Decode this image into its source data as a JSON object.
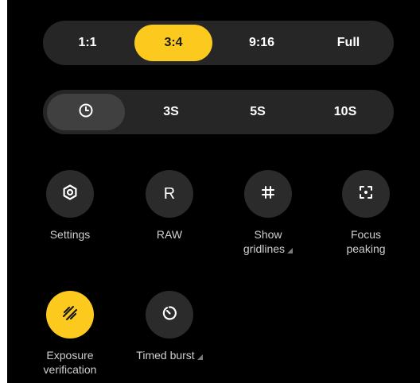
{
  "aspect_ratio": {
    "options": [
      "1:1",
      "3:4",
      "9:16",
      "Full"
    ],
    "selected": "3:4"
  },
  "timer": {
    "options": [
      "clock-icon",
      "3S",
      "5S",
      "10S"
    ],
    "selected": "clock-icon"
  },
  "tiles": [
    {
      "icon": "gear-icon",
      "label": "Settings",
      "active": false
    },
    {
      "icon": "raw-icon",
      "glyph": "R",
      "label": "RAW",
      "active": false
    },
    {
      "icon": "grid-icon",
      "label": "Show\ngridlines",
      "active": false,
      "has_more": true
    },
    {
      "icon": "focus-peaking-icon",
      "label": "Focus\npeaking",
      "active": false
    },
    {
      "icon": "exposure-stripes-icon",
      "label": "Exposure\nverification",
      "active": true
    },
    {
      "icon": "timer-icon",
      "label": "Timed burst",
      "active": false,
      "has_more": true
    }
  ],
  "colors": {
    "background": "#000000",
    "surface": "#262626",
    "accent": "#fcca1e",
    "text": "#ffffff",
    "label": "#cfcfcf"
  }
}
